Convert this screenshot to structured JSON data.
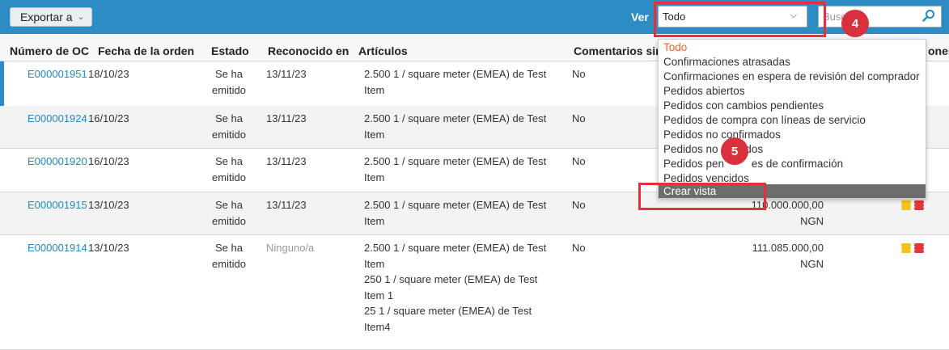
{
  "toolbar": {
    "export_label": "Exportar a",
    "ver_label": "Ver",
    "view_selected": "Todo",
    "search_placeholder": "Busc"
  },
  "columns": {
    "po": "Número de OC",
    "date": "Fecha de la orden",
    "estado": "Estado",
    "reconocido": "Reconocido en",
    "articulos": "Artículos",
    "comentarios": "Comentarios sin",
    "acciones_tail": "ones"
  },
  "rows": [
    {
      "po": "E000001951",
      "date": "18/10/23",
      "estado_1": "Se ha",
      "estado_2": "emitido",
      "rec": "13/11/23",
      "items": [
        "2.500 1 / square meter (EMEA) de Test",
        "Item"
      ],
      "coment": "No",
      "total_1": "",
      "total_2": ""
    },
    {
      "po": "E000001924",
      "date": "16/10/23",
      "estado_1": "Se ha",
      "estado_2": "emitido",
      "rec": "13/11/23",
      "items": [
        "2.500 1 / square meter (EMEA) de Test",
        "Item"
      ],
      "coment": "No",
      "total_1": "",
      "total_2": ""
    },
    {
      "po": "E000001920",
      "date": "16/10/23",
      "estado_1": "Se ha",
      "estado_2": "emitido",
      "rec": "13/11/23",
      "items": [
        "2.500 1 / square meter (EMEA) de Test",
        "Item"
      ],
      "coment": "No",
      "total_1": "",
      "total_2": ""
    },
    {
      "po": "E000001915",
      "date": "13/10/23",
      "estado_1": "Se ha",
      "estado_2": "emitido",
      "rec": "13/11/23",
      "items": [
        "2.500 1 / square meter (EMEA) de Test",
        "Item"
      ],
      "coment": "No",
      "total_1": "110.000.000,00",
      "total_2": "NGN"
    },
    {
      "po": "E000001914",
      "date": "13/10/23",
      "estado_1": "Se ha",
      "estado_2": "emitido",
      "rec": "Ninguno/a",
      "items": [
        "2.500 1 / square meter (EMEA) de Test",
        "Item",
        "250 1 / square meter (EMEA) de Test",
        "Item 1",
        "25 1 / square meter (EMEA) de Test",
        "Item4"
      ],
      "coment": "No",
      "total_1": "111.085.000,00",
      "total_2": "NGN"
    }
  ],
  "dropdown": {
    "options": [
      "Todo",
      "Confirmaciones atrasadas",
      "Confirmaciones en espera de revisión del comprador",
      "Pedidos abiertos",
      "Pedidos con cambios pendientes",
      "Pedidos de compra con líneas de servicio",
      "Pedidos no confirmados",
      "Pedidos no         dos",
      "Pedidos pen         es de confirmación",
      "Pedidos vencidos"
    ],
    "footer": "Crear vista"
  },
  "callouts": {
    "step4": "4",
    "step5": "5"
  },
  "colors": {
    "toolbar": "#2d8cc4",
    "link": "#1a8ac8",
    "highlight": "#e2303d",
    "active_option": "#e36a2c",
    "coin_yellow": "#f0c419",
    "coin_red": "#e0363f"
  },
  "icons": {
    "export_chevron": "chevron-down-icon",
    "select_chevron": "chevron-down-icon",
    "search": "search-icon",
    "coins": "coin-stack-icon"
  }
}
